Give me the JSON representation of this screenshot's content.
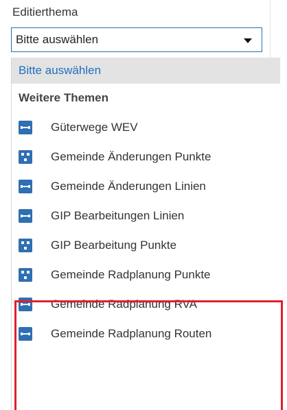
{
  "field": {
    "label": "Editierthema",
    "selected_value": "Bitte auswählen"
  },
  "dropdown": {
    "placeholder_option": "Bitte auswählen",
    "group_label": "Weitere Themen",
    "items": [
      {
        "label": "Güterwege WEV",
        "icon": "line-layer-icon"
      },
      {
        "label": "Gemeinde Änderungen Punkte",
        "icon": "point-layer-icon"
      },
      {
        "label": "Gemeinde Änderungen Linien",
        "icon": "line-layer-icon"
      },
      {
        "label": "GIP Bearbeitungen Linien",
        "icon": "line-layer-icon"
      },
      {
        "label": "GIP Bearbeitung Punkte",
        "icon": "point-layer-icon"
      },
      {
        "label": "Gemeinde Radplanung Punkte",
        "icon": "point-layer-icon"
      },
      {
        "label": "Gemeinde Radplanung RVA",
        "icon": "line-layer-icon"
      },
      {
        "label": "Gemeinde Radplanung Routen",
        "icon": "line-layer-icon"
      }
    ]
  },
  "colors": {
    "accent": "#2f6fb3",
    "placeholder_text": "#1f6fbf",
    "highlight_frame": "#e0202a"
  }
}
